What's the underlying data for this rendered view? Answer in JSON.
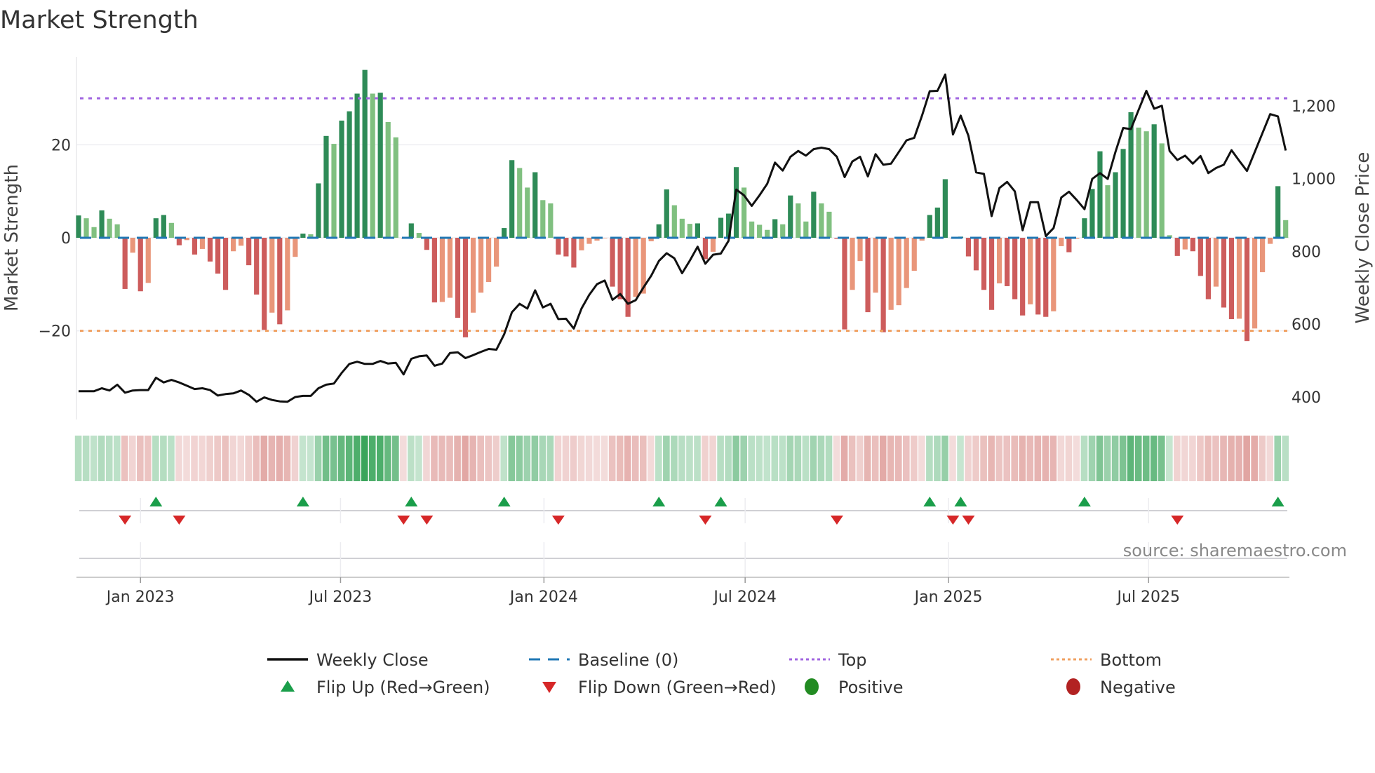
{
  "title": "Market Strength",
  "source_note": "source: sharemaestro.com",
  "chart_data": {
    "type": "bar",
    "title": "Market Strength",
    "start_week": "2022-11-06",
    "interval_days": 7,
    "ylabel": "Market Strength",
    "y2label": "Weekly Close Price",
    "ylim": [
      -39,
      39
    ],
    "y2lim": [
      320,
      1400
    ],
    "yticks": [
      {
        "value": 20,
        "label": "20"
      },
      {
        "value": 0,
        "label": "0"
      },
      {
        "value": -20,
        "label": "−20"
      }
    ],
    "y2ticks": [
      {
        "value": 400,
        "label": "400"
      },
      {
        "value": 600,
        "label": "600"
      },
      {
        "value": 800,
        "label": "800"
      },
      {
        "value": 1000,
        "label": "1,000"
      },
      {
        "value": 1200,
        "label": "1,200"
      }
    ],
    "xticks": [
      {
        "date": "2023-01-01",
        "label": "Jan 2023"
      },
      {
        "date": "2023-07-01",
        "label": "Jul 2023"
      },
      {
        "date": "2024-01-01",
        "label": "Jan 2024"
      },
      {
        "date": "2024-07-01",
        "label": "Jul 2024"
      },
      {
        "date": "2025-01-01",
        "label": "Jan 2025"
      },
      {
        "date": "2025-07-01",
        "label": "Jul 2025"
      }
    ],
    "top_level": 30,
    "bottom_level": -20,
    "grid": true,
    "legend_position": "bottom",
    "strength": [
      4.8,
      4.2,
      2.3,
      5.9,
      4.1,
      2.9,
      -11,
      -3.2,
      -11.5,
      -9.7,
      4.2,
      4.9,
      3.2,
      -1.6,
      -0.5,
      -3.6,
      -2.4,
      -5.1,
      -7.7,
      -11.2,
      -2.9,
      -1.7,
      -5.9,
      -12.2,
      -19.8,
      -16.1,
      -18.6,
      -15.6,
      -4.1,
      0.9,
      0.75,
      11.7,
      21.9,
      20.2,
      25.2,
      27.2,
      31,
      36.1,
      31,
      31.2,
      24.9,
      21.6,
      -0.1,
      3.1,
      1.05,
      -2.6,
      -13.9,
      -13.8,
      -12.9,
      -17.2,
      -21.4,
      -16.1,
      -11.8,
      -9.5,
      -6.2,
      2.1,
      16.7,
      15,
      10.8,
      14.1,
      8.1,
      7.4,
      -3.6,
      -4,
      -6.4,
      -2.7,
      -1.3,
      -0.6,
      -0.1,
      -10.5,
      -13.2,
      -17,
      -12.7,
      -12,
      -0.75,
      2.9,
      10.4,
      7,
      4.1,
      3,
      3.1,
      -4.6,
      -3,
      4.3,
      5.2,
      15.2,
      10.8,
      3.5,
      2.8,
      1.7,
      4,
      2.9,
      9.1,
      7.4,
      3.5,
      9.9,
      7.4,
      5.6,
      -0.2,
      -19.7,
      -11.2,
      -5,
      -16,
      -11.8,
      -20.3,
      -15.5,
      -14.5,
      -10.8,
      -7.1,
      -0.6,
      4.9,
      6.5,
      12.6,
      -0.1,
      0.25,
      -4,
      -7,
      -11.2,
      -15.5,
      -9.8,
      -10.4,
      -13.2,
      -16.7,
      -14.3,
      -16.5,
      -17,
      -15.8,
      -1.8,
      -3.1,
      -0.2,
      4.2,
      10.5,
      18.6,
      11.3,
      14.1,
      19.1,
      27,
      23.7,
      22.9,
      24.4,
      20.3,
      0.55,
      -3.9,
      -2.5,
      -2.9,
      -8.2,
      -13.2,
      -10.5,
      -15,
      -17.5,
      -17.4,
      -22.2,
      -19.5,
      -7.4,
      -1.3,
      11.1,
      3.8
    ],
    "weekly_close": [
      416,
      416,
      416,
      424,
      418,
      434,
      412,
      418,
      419,
      419,
      453,
      440,
      447,
      440,
      431,
      422,
      424,
      419,
      404,
      408,
      410,
      418,
      406,
      387,
      399,
      392,
      388,
      387,
      400,
      403,
      403,
      424,
      434,
      437,
      466,
      491,
      497,
      491,
      491,
      499,
      492,
      494,
      462,
      505,
      512,
      514,
      486,
      492,
      521,
      523,
      507,
      515,
      524,
      532,
      530,
      572,
      633,
      656,
      643,
      693,
      646,
      656,
      614,
      615,
      588,
      643,
      681,
      710,
      720,
      667,
      683,
      656,
      666,
      701,
      733,
      774,
      795,
      781,
      740,
      775,
      813,
      766,
      791,
      794,
      829,
      970,
      954,
      925,
      954,
      986,
      1044,
      1022,
      1060,
      1076,
      1063,
      1081,
      1085,
      1081,
      1060,
      1004,
      1047,
      1060,
      1006,
      1067,
      1038,
      1041,
      1073,
      1105,
      1112,
      1173,
      1240,
      1241,
      1286,
      1121,
      1173,
      1118,
      1017,
      1013,
      897,
      974,
      991,
      965,
      858,
      935,
      935,
      842,
      864,
      948,
      964,
      941,
      916,
      999,
      1015,
      999,
      1073,
      1139,
      1136,
      1189,
      1241,
      1192,
      1200,
      1076,
      1051,
      1063,
      1041,
      1062,
      1015,
      1029,
      1038,
      1078,
      1049,
      1021,
      1073,
      1125,
      1177,
      1171,
      1077
    ],
    "legend": [
      {
        "key": "close",
        "label": "Weekly Close"
      },
      {
        "key": "baseline",
        "label": "Baseline (0)"
      },
      {
        "key": "top",
        "label": "Top"
      },
      {
        "key": "bottom",
        "label": "Bottom"
      },
      {
        "key": "flip_up",
        "label": "Flip Up (Red→Green)"
      },
      {
        "key": "flip_down",
        "label": "Flip Down (Green→Red)"
      },
      {
        "key": "positive",
        "label": "Positive"
      },
      {
        "key": "negative",
        "label": "Negative"
      }
    ],
    "colors": {
      "pos_rising": "#2e8b57",
      "pos_falling": "#80c080",
      "neg_falling": "#cd5c5c",
      "neg_rising": "#e9967a",
      "close": "#111111",
      "baseline": "#1f77b4",
      "top": "#a064e0",
      "bottom": "#f0a060",
      "flip_up": "#1a9e4a",
      "flip_down": "#d62728",
      "positive": "#228b22",
      "negative": "#b22222",
      "strip_pos": "#3aa55b",
      "strip_neg": "#d6837f"
    }
  }
}
